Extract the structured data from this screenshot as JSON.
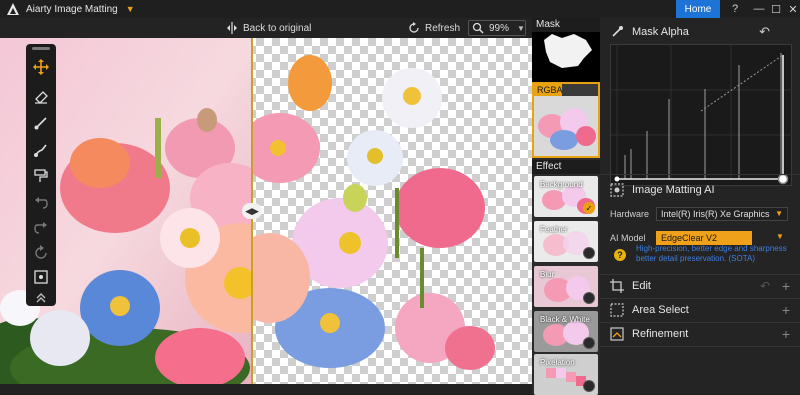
{
  "app": {
    "title": "Aiarty Image Matting",
    "home_label": "Home"
  },
  "window_controls": {
    "help": "?",
    "minimize": "—",
    "maximize": "☐",
    "close": "✕"
  },
  "toolbar": {
    "back_label": "Back to original",
    "refresh_label": "Refresh",
    "zoom": "99%"
  },
  "tools": [
    "move-tool",
    "eraser-tool",
    "brush-tool",
    "paint-tool",
    "fill-tool",
    "undo",
    "redo",
    "reset",
    "crop-tool",
    "collapse"
  ],
  "thumbnails": {
    "mask_label": "Mask",
    "rgba_label": "RGBA",
    "effect_label": "Effect",
    "effects": [
      {
        "label": "Background",
        "selected": true
      },
      {
        "label": "Feather",
        "selected": false
      },
      {
        "label": "Blur",
        "selected": false
      },
      {
        "label": "Black & White",
        "selected": false
      },
      {
        "label": "Pixelation",
        "selected": false
      }
    ]
  },
  "panel": {
    "mask_alpha": "Mask Alpha",
    "matting_title": "Image Matting AI",
    "hardware_label": "Hardware",
    "hardware_value": "Intel(R) Iris(R) Xe Graphics",
    "model_label": "AI Model",
    "model_value": "EdgeClear  V2",
    "model_desc": "High-precision, better edge and sharpness better detail preservation. (SOTA)",
    "edit_label": "Edit",
    "area_select_label": "Area Select",
    "refinement_label": "Refinement"
  },
  "colors": {
    "accent": "#e8a212",
    "home_blue": "#1e74d6",
    "link_blue": "#3f7fe0"
  }
}
